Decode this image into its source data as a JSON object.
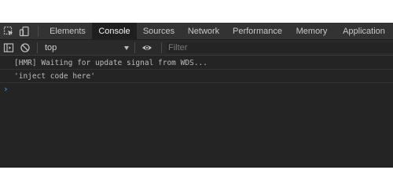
{
  "toolbar": {
    "inspect_icon": "inspect-element-icon",
    "device_icon": "device-toolbar-icon"
  },
  "tabs": [
    {
      "label": "Elements",
      "active": false
    },
    {
      "label": "Console",
      "active": true
    },
    {
      "label": "Sources",
      "active": false
    },
    {
      "label": "Network",
      "active": false
    },
    {
      "label": "Performance",
      "active": false
    },
    {
      "label": "Memory",
      "active": false
    },
    {
      "label": "Application",
      "active": false
    }
  ],
  "filterbar": {
    "sidebar_icon": "sidebar-toggle-icon",
    "clear_icon": "clear-console-icon",
    "context": "top",
    "eye_icon": "eye-icon",
    "filter_placeholder": "Filter"
  },
  "console": {
    "messages": [
      "[HMR] Waiting for update signal from WDS...",
      "'inject code here'"
    ],
    "prompt_symbol": "›"
  },
  "colors": {
    "background": "#242424",
    "tabbar": "#333333",
    "active_tab": "#1f1f1f",
    "prompt": "#4f9cf5"
  }
}
